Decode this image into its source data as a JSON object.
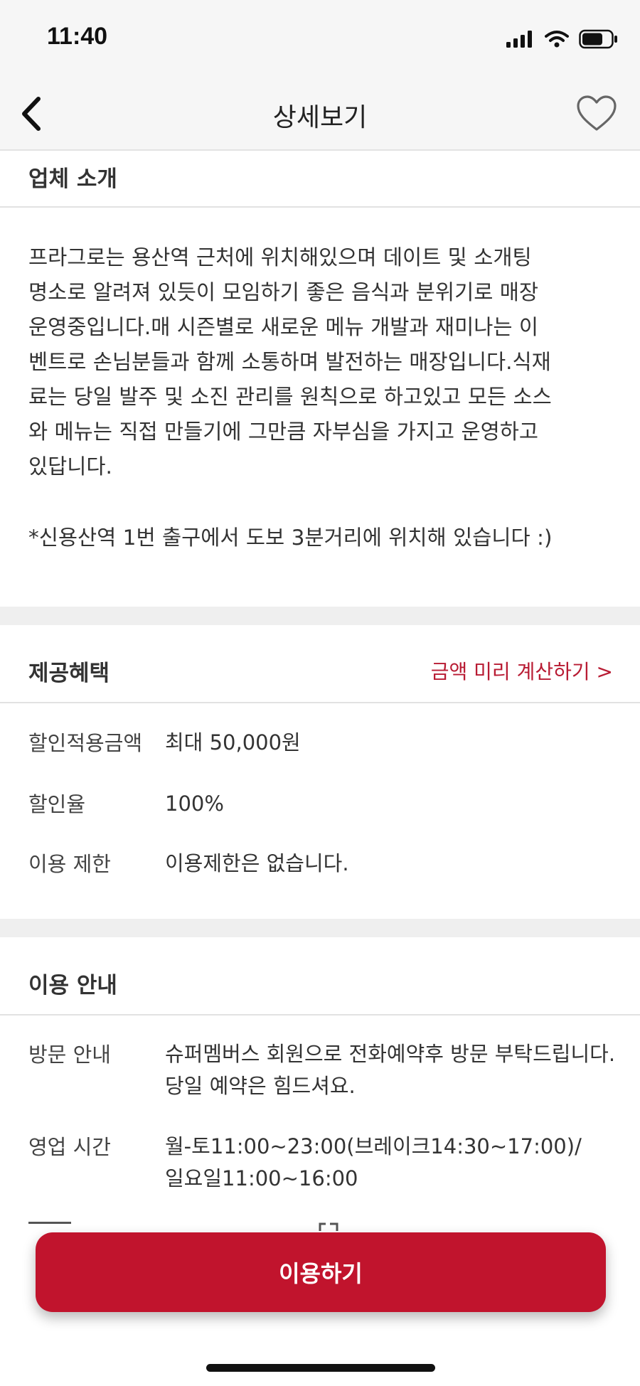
{
  "status": {
    "time": "11:40"
  },
  "nav": {
    "title": "상세보기"
  },
  "intro": {
    "title": "업체 소개",
    "body": "프라그로는 용산역 근처에 위치해있으며 데이트 및 소개팅\n명소로 알려져 있듯이 모임하기 좋은 음식과 분위기로 매장\n운영중입니다.매 시즌별로 새로운 메뉴 개발과 재미나는 이\n벤트로 손님분들과 함께 소통하며 발전하는 매장입니다.식재\n료는 당일 발주 및 소진 관리를 원칙으로 하고있고 모든 소스\n와 메뉴는 직접 만들기에 그만큼 자부심을 가지고 운영하고\n있답니다.",
    "note": "*신용산역 1번 출구에서 도보 3분거리에 위치해 있습니다 :)"
  },
  "benefits": {
    "title": "제공혜택",
    "link": "금액 미리 계산하기 >",
    "rows": [
      {
        "label": "할인적용금액",
        "value": "최대 50,000원"
      },
      {
        "label": "할인율",
        "value": "100%"
      },
      {
        "label": "이용 제한",
        "value": "이용제한은 없습니다."
      }
    ]
  },
  "usage": {
    "title": "이용 안내",
    "rows": [
      {
        "label": "방문 안내",
        "value": "슈퍼멤버스 회원으로 전화예약후 방문 부탁드립니다. 당일 예약은 힘드셔요."
      },
      {
        "label": "영업 시간",
        "value": "월-토11:00~23:00(브레이크14:30~17:00)/일요일11:00~16:00"
      }
    ]
  },
  "cta": {
    "label": "이용하기"
  },
  "colors": {
    "accent": "#c1142d",
    "link": "#b81b33"
  }
}
